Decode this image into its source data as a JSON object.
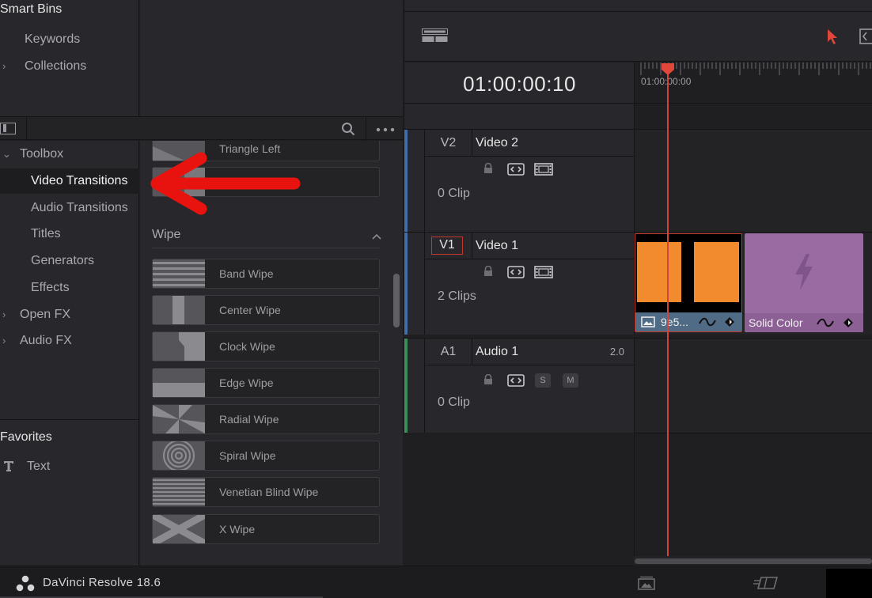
{
  "app": {
    "title": "DaVinci Resolve 18.6"
  },
  "smart_bins": {
    "header": "Smart Bins",
    "items": [
      {
        "label": "Keywords"
      },
      {
        "label": "Collections"
      }
    ]
  },
  "toolbox": {
    "header": "Toolbox",
    "items": [
      {
        "label": "Video Transitions",
        "selected": true
      },
      {
        "label": "Audio Transitions"
      },
      {
        "label": "Titles"
      },
      {
        "label": "Generators"
      },
      {
        "label": "Effects"
      }
    ],
    "groups": [
      {
        "label": "Open FX"
      },
      {
        "label": "Audio FX"
      }
    ]
  },
  "favorites": {
    "header": "Favorites",
    "items": [
      {
        "label": "Text",
        "icon": "text-T-icon"
      }
    ]
  },
  "transitions": {
    "partial_items": [
      {
        "label": "Triangle Left"
      }
    ],
    "wipe_header": "Wipe",
    "wipe_items": [
      {
        "label": "Band Wipe"
      },
      {
        "label": "Center Wipe"
      },
      {
        "label": "Clock Wipe"
      },
      {
        "label": "Edge Wipe"
      },
      {
        "label": "Radial Wipe"
      },
      {
        "label": "Spiral Wipe"
      },
      {
        "label": "Venetian Blind Wipe"
      },
      {
        "label": "X Wipe"
      }
    ]
  },
  "timeline": {
    "timecode": "01:00:00:10",
    "ruler_start": "01:00:00:00",
    "tracks": [
      {
        "id": "V2",
        "name": "Video 2",
        "clips_label": "0 Clip",
        "color": "#3f6ea8"
      },
      {
        "id": "V1",
        "name": "Video 1",
        "clips_label": "2 Clips",
        "color": "#3f6ea8"
      },
      {
        "id": "A1",
        "name": "Audio 1",
        "clips_label": "0 Clip",
        "level": "2.0",
        "color": "#3d8f5a",
        "solo": "S",
        "mute": "M"
      }
    ],
    "clips": [
      {
        "name": "9e5...",
        "color": "#4f6b85"
      },
      {
        "name": "Solid Color",
        "color": "#9a6aa3"
      }
    ]
  },
  "colors": {
    "accent_red": "#d0463b",
    "clip_orange": "#f28a2e",
    "clip_purple": "#9a6aa3"
  }
}
